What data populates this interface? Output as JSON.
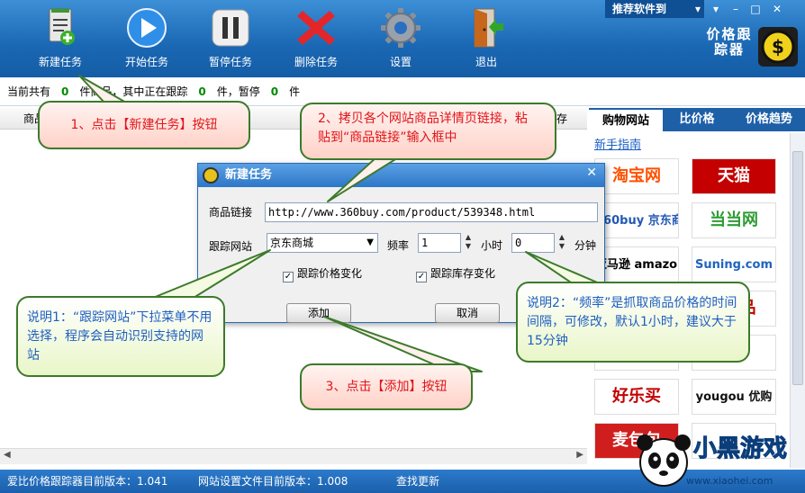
{
  "toolbar": {
    "buttons": [
      {
        "label": "新建任务",
        "icon": "new-task-icon"
      },
      {
        "label": "开始任务",
        "icon": "play-icon"
      },
      {
        "label": "暂停任务",
        "icon": "pause-icon"
      },
      {
        "label": "删除任务",
        "icon": "delete-icon"
      },
      {
        "label": "设置",
        "icon": "gear-icon"
      },
      {
        "label": "退出",
        "icon": "exit-door-icon"
      }
    ],
    "recommend": "推荐软件到",
    "logo_text": "价格跟踪器"
  },
  "stats": {
    "prefix": "当前共有",
    "total": "0",
    "middle": "件商品，其中正在跟踪",
    "tracking": "0",
    "paused_label": "件，暂停",
    "paused": "0",
    "suffix": "件"
  },
  "list": {
    "col1": "商品",
    "col2": "存"
  },
  "side": {
    "tabs": [
      "购物网站",
      "比价格",
      "价格趋势"
    ],
    "guide": "新手指南",
    "sites": [
      {
        "text": "淘宝网",
        "color": "#ff5000",
        "bg": "#ffffff"
      },
      {
        "text": "天猫",
        "color": "#ffffff",
        "bg": "#c40000"
      },
      {
        "text": "360buy 京东商城",
        "color": "#2359b4",
        "bg": "#ffffff"
      },
      {
        "text": "当当网",
        "color": "#2e9c34",
        "bg": "#ffffff"
      },
      {
        "text": "亚马逊 amazon.cn",
        "color": "#000000",
        "bg": "#ffffff"
      },
      {
        "text": "Suning.com",
        "color": "#1f63bf",
        "bg": "#ffffff"
      },
      {
        "text": "",
        "color": "#000000",
        "bg": "#ffffff"
      },
      {
        "text": "CL 品",
        "color": "#c40000",
        "bg": "#ffffff"
      },
      {
        "text": "",
        "color": "#1a5fc2",
        "bg": "#ffffff"
      },
      {
        "text": "",
        "color": "#1a5fc2",
        "bg": "#ffffff"
      },
      {
        "text": "好乐买",
        "color": "#c40000",
        "bg": "#ffffff"
      },
      {
        "text": "yougou 优购",
        "color": "#111111",
        "bg": "#ffffff"
      },
      {
        "text": "麦包包",
        "color": "#ffffff",
        "bg": "#d01e1e"
      },
      {
        "text": "",
        "color": "#000000",
        "bg": "#ffffff"
      }
    ]
  },
  "status": {
    "version": "爱比价格跟踪器目前版本：1.041",
    "config": "网站设置文件目前版本：1.008",
    "update": "查找更新",
    "watermark": "小黑游戏",
    "watermark_url": "www.xiaohei.com"
  },
  "dialog": {
    "title": "新建任务",
    "link_label": "商品链接",
    "link_value": "http://www.360buy.com/product/539348.html",
    "site_label": "跟踪网站",
    "site_value": "京东商城",
    "freq_label": "频率",
    "freq_hours": "1",
    "hour_unit": "小时",
    "freq_minutes": "0",
    "minute_unit": "分钟",
    "track_price": "跟踪价格变化",
    "track_stock": "跟踪库存变化",
    "add": "添加",
    "cancel": "取消"
  },
  "callouts": {
    "c1": "1、点击【新建任务】按钮",
    "c2": "2、拷贝各个网站商品详情页链接，粘贴到“商品链接”输入框中",
    "c3": "说明1：“跟踪网站”下拉菜单不用选择，程序会自动识别支持的网站",
    "c4": "说明2：“频率”是抓取商品价格的时间间隔，可修改，默认1小时，建议大于15分钟",
    "c5": "3、点击【添加】按钮"
  },
  "colors": {
    "toolbar_blue": "#1a67b3",
    "callout_red_text": "#e1141a",
    "callout_blue_text": "#1f5fc1",
    "callout_border": "#3c7a2b"
  }
}
